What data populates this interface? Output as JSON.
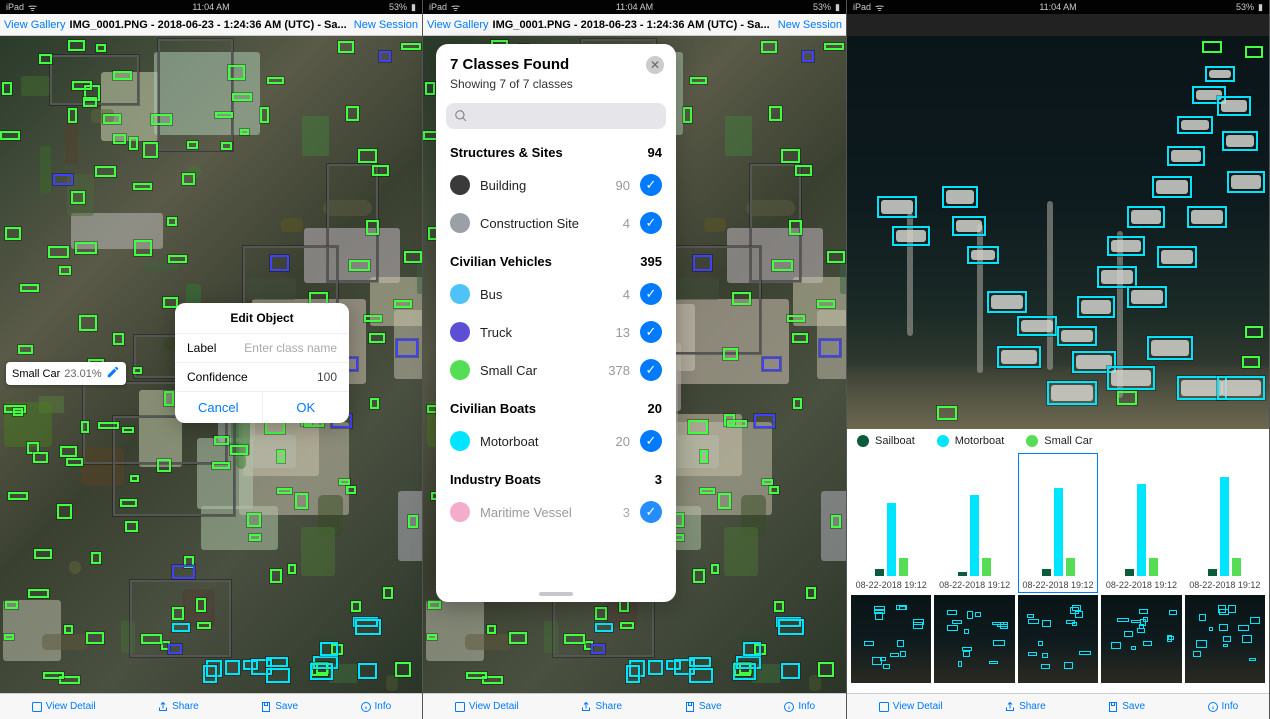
{
  "status": {
    "device": "iPad",
    "time": "11:04 AM",
    "battery": "53%"
  },
  "header": {
    "left": "View Gallery",
    "title": "IMG_0001.PNG - 2018-06-23 - 1:24:36 AM (UTC) - Sa...",
    "right": "New Session"
  },
  "edit_object": {
    "title": "Edit Object",
    "label_text": "Label",
    "label_placeholder": "Enter class name",
    "confidence_text": "Confidence",
    "confidence_value": "100",
    "cancel": "Cancel",
    "ok": "OK"
  },
  "label_tag": {
    "name": "Small Car",
    "pct": "23.01%"
  },
  "classes_popover": {
    "title": "7 Classes Found",
    "subtitle": "Showing 7 of 7 classes",
    "sections": [
      {
        "name": "Structures & Sites",
        "count": "94",
        "items": [
          {
            "name": "Building",
            "count": "90",
            "color": "#3a3a3a"
          },
          {
            "name": "Construction Site",
            "count": "4",
            "color": "#9aa0a6"
          }
        ]
      },
      {
        "name": "Civilian Vehicles",
        "count": "395",
        "items": [
          {
            "name": "Bus",
            "count": "4",
            "color": "#4fc3f7"
          },
          {
            "name": "Truck",
            "count": "13",
            "color": "#5c4fd6"
          },
          {
            "name": "Small Car",
            "count": "378",
            "color": "#55dd55"
          }
        ]
      },
      {
        "name": "Civilian Boats",
        "count": "20",
        "items": [
          {
            "name": "Motorboat",
            "count": "20",
            "color": "#00e5ff"
          }
        ]
      },
      {
        "name": "Industry Boats",
        "count": "3",
        "items": [
          {
            "name": "Maritime Vessel",
            "count": "3",
            "color": "#f19fc3"
          }
        ]
      }
    ]
  },
  "bottom_toolbar": {
    "view_detail": "View Detail",
    "share": "Share",
    "save": "Save",
    "info": "Info"
  },
  "legend": {
    "items": [
      {
        "name": "Sailboat",
        "color": "#0b5a3a"
      },
      {
        "name": "Motorboat",
        "color": "#00e5ff"
      },
      {
        "name": "Small Car",
        "color": "#55dd55"
      }
    ]
  },
  "chart_data": {
    "type": "bar",
    "categories": [
      "08-22-2018 19:12",
      "08-22-2018 19:12",
      "08-22-2018 19:12",
      "08-22-2018 19:12",
      "08-22-2018 19:12"
    ],
    "series": [
      {
        "name": "Sailboat",
        "values": [
          2,
          1,
          2,
          2,
          2
        ],
        "color": "#0b5a3a"
      },
      {
        "name": "Motorboat",
        "values": [
          20,
          22,
          24,
          25,
          27
        ],
        "color": "#00e5ff"
      },
      {
        "name": "Small Car",
        "values": [
          5,
          5,
          5,
          5,
          5
        ],
        "color": "#55dd55"
      }
    ],
    "ylim": [
      0,
      30
    ],
    "selected_index": 2
  }
}
